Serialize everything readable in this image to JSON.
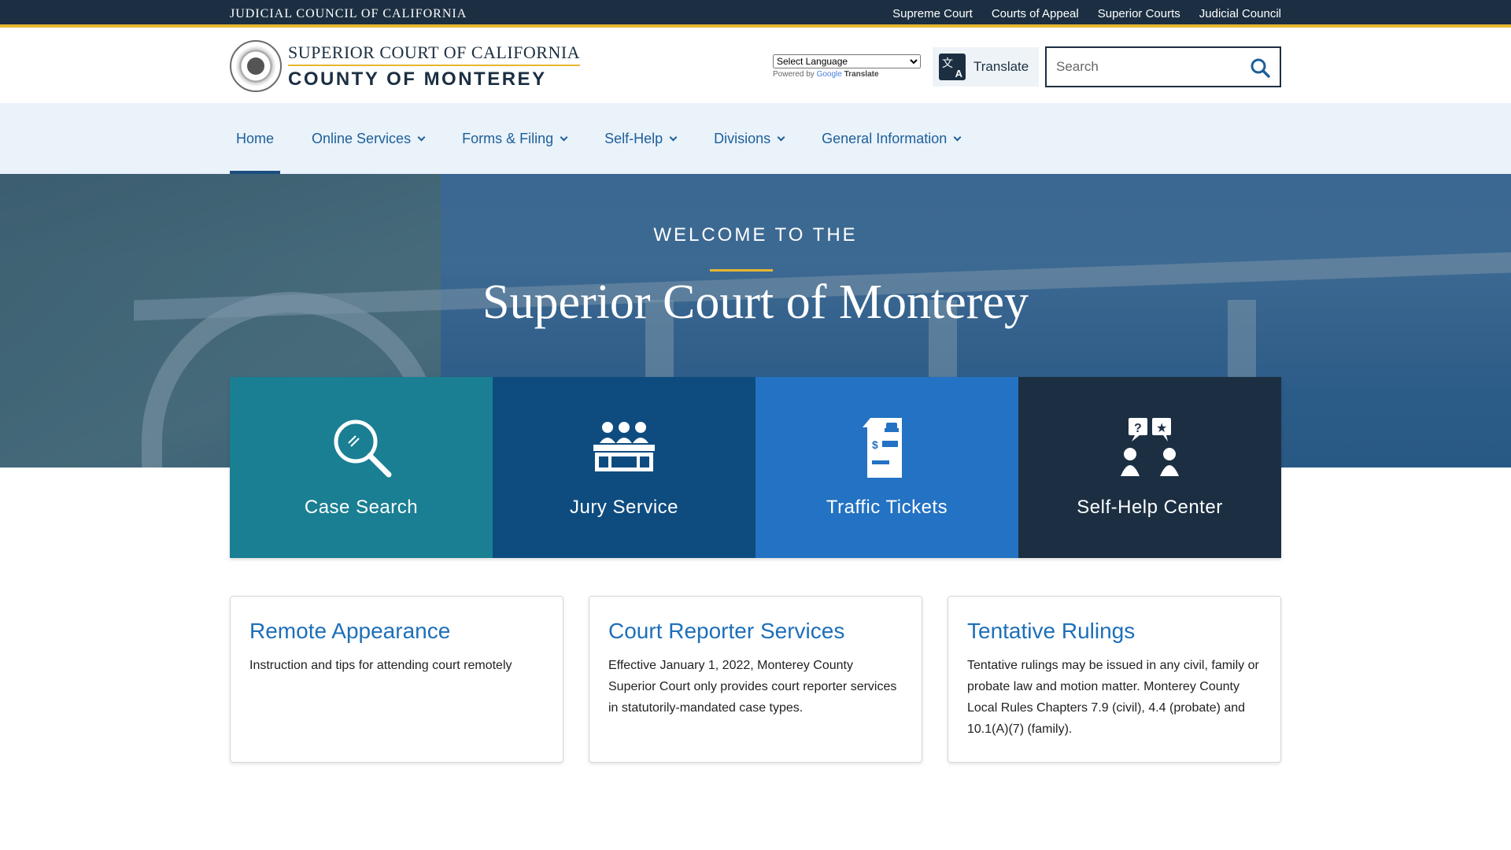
{
  "topbar": {
    "brand": "Judicial Council of California",
    "links": [
      "Supreme Court",
      "Courts of Appeal",
      "Superior Courts",
      "Judicial Council"
    ]
  },
  "header": {
    "logo_line1": "Superior Court of California",
    "logo_line2": "County of Monterey",
    "language_select": "Select Language",
    "powered_by": "Powered by",
    "google": "Google",
    "translate_word": "Translate",
    "translate_button": "Translate",
    "search_placeholder": "Search"
  },
  "nav": {
    "items": [
      {
        "label": "Home",
        "has_menu": false,
        "active": true
      },
      {
        "label": "Online Services",
        "has_menu": true
      },
      {
        "label": "Forms & Filing",
        "has_menu": true
      },
      {
        "label": "Self-Help",
        "has_menu": true
      },
      {
        "label": "Divisions",
        "has_menu": true
      },
      {
        "label": "General Information",
        "has_menu": true
      }
    ]
  },
  "hero": {
    "welcome": "Welcome to the",
    "title": "Superior Court of Monterey"
  },
  "tiles": [
    {
      "label": "Case Search",
      "icon": "magnifier-icon",
      "color": "#1a7f93"
    },
    {
      "label": "Jury Service",
      "icon": "jury-box-icon",
      "color": "#0e4c80"
    },
    {
      "label": "Traffic Tickets",
      "icon": "traffic-ticket-icon",
      "color": "#2372c3"
    },
    {
      "label": "Self-Help Center",
      "icon": "help-conversation-icon",
      "color": "#1c2f42"
    }
  ],
  "cards": [
    {
      "title": "Remote Appearance",
      "text": "Instruction and tips for attending court remotely"
    },
    {
      "title": "Court Reporter Services",
      "text": "Effective January 1, 2022, Monterey County Superior Court only provides court reporter services in statutorily-mandated case types."
    },
    {
      "title": "Tentative Rulings",
      "text": "Tentative rulings may be issued in any civil, family or probate law and motion matter.  Monterey County Local Rules Chapters 7.9 (civil), 4.4 (probate) and 10.1(A)(7) (family)."
    }
  ],
  "colors": {
    "navy": "#1c2f42",
    "gold": "#e5b731",
    "link_blue": "#1d6fb8"
  }
}
